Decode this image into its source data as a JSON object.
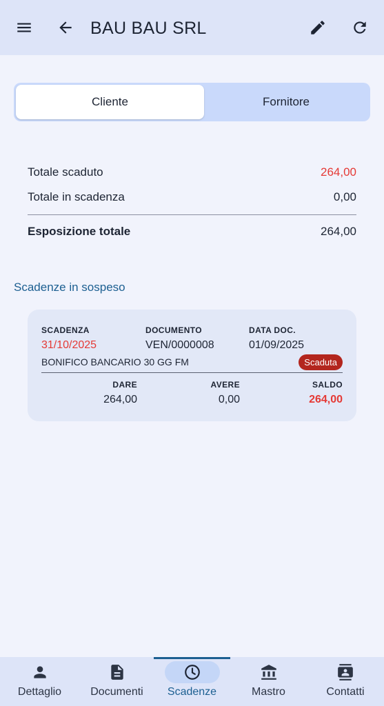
{
  "header": {
    "title": "BAU BAU SRL"
  },
  "segmented": {
    "options": [
      "Cliente",
      "Fornitore"
    ],
    "selected": "Cliente"
  },
  "totals": {
    "scaduto": {
      "label": "Totale scaduto",
      "value": "264,00"
    },
    "in_scadenza": {
      "label": "Totale in scadenza",
      "value": "0,00"
    },
    "esposizione": {
      "label": "Esposizione totale",
      "value": "264,00"
    }
  },
  "section_title": "Scadenze in sospeso",
  "scadenze": [
    {
      "headers": {
        "scadenza": "SCADENZA",
        "documento": "DOCUMENTO",
        "data_doc": "DATA DOC."
      },
      "scadenza": "31/10/2025",
      "documento": "VEN/0000008",
      "data_doc": "01/09/2025",
      "metodo": "BONIFICO BANCARIO 30 GG FM",
      "stato": "Scaduta",
      "amount_headers": {
        "dare": "DARE",
        "avere": "AVERE",
        "saldo": "SALDO"
      },
      "dare": "264,00",
      "avere": "0,00",
      "saldo": "264,00"
    }
  ],
  "bottom_nav": [
    {
      "label": "Dettaglio",
      "icon": "person-icon"
    },
    {
      "label": "Documenti",
      "icon": "document-icon"
    },
    {
      "label": "Scadenze",
      "icon": "clock-icon",
      "active": true
    },
    {
      "label": "Mastro",
      "icon": "bank-icon"
    },
    {
      "label": "Contatti",
      "icon": "contacts-icon"
    }
  ],
  "colors": {
    "accent": "#1c5f91",
    "overdue": "#e53935",
    "badge": "#b3261e",
    "appbar": "#dde4f8"
  }
}
